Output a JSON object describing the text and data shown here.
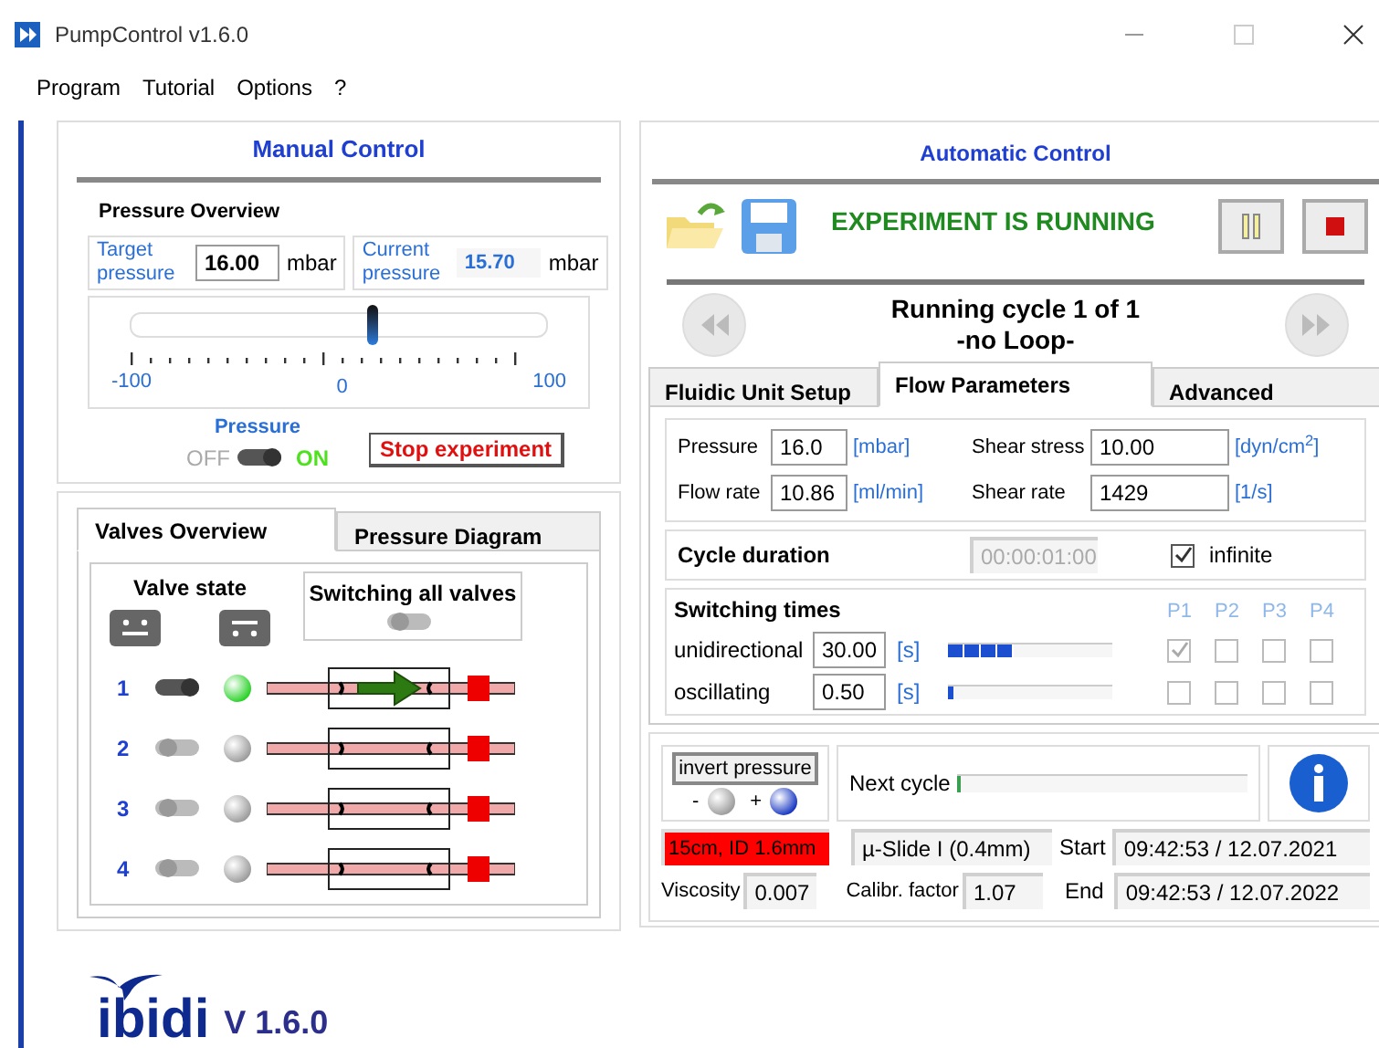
{
  "window": {
    "title": "PumpControl v1.6.0"
  },
  "menu": [
    "Program",
    "Tutorial",
    "Options",
    "?"
  ],
  "manual_control": {
    "title": "Manual Control",
    "section": "Pressure Overview",
    "target": {
      "label": "Target pressure",
      "value": "16.00",
      "unit": "mbar"
    },
    "current": {
      "label": "Current pressure",
      "value": "15.70",
      "unit": "mbar"
    },
    "slider": {
      "level": 0.58,
      "labels": [
        "-100",
        "0",
        "100"
      ]
    },
    "pressure_label": "Pressure",
    "toggle": {
      "off_label": "OFF",
      "on_label": "ON",
      "on": true
    },
    "stop_button": "Stop experiment"
  },
  "left_tabs": [
    {
      "label": "Valves Overview",
      "selected": true
    },
    {
      "label": "Pressure Diagram",
      "selected": false
    }
  ],
  "valves": {
    "state_label": "Valve state",
    "switch_all_label": "Switching all valves",
    "rows": [
      {
        "number": "1",
        "on": true
      },
      {
        "number": "2",
        "on": false
      },
      {
        "number": "3",
        "on": false
      },
      {
        "number": "4",
        "on": false
      }
    ]
  },
  "logo": {
    "brand": "ibidi",
    "version": "V 1.6.0"
  },
  "automatic_control": {
    "title": "Automatic Control",
    "status": "EXPERIMENT IS RUNNING",
    "cycle_lines": [
      "Running cycle 1 of 1",
      "-no Loop-"
    ],
    "tabs": [
      {
        "label": "Fluidic Unit Setup",
        "selected": false
      },
      {
        "label": "Flow Parameters",
        "selected": true
      },
      {
        "label": "Advanced",
        "selected": false
      }
    ],
    "params": [
      {
        "label": "Pressure",
        "value": "16.0",
        "unit": "[mbar]"
      },
      {
        "label": "Shear stress",
        "value": "10.00",
        "unit": "[dyn/cm$^{2}$]"
      },
      {
        "label": "Flow rate",
        "value": "10.86",
        "unit": "[ml/min]"
      },
      {
        "label": "Shear rate",
        "value": "1429",
        "unit": "[1/s]"
      }
    ],
    "cycle_duration": {
      "label": "Cycle duration",
      "value": "00:00:01:00",
      "infinite_label": "infinite",
      "infinite": true
    },
    "switching": {
      "title": "Switching times",
      "columns": [
        "P1",
        "P2",
        "P3",
        "P4"
      ],
      "rows": [
        {
          "label": "unidirectional",
          "value": "30.00",
          "unit": "[s]",
          "level": 0.4,
          "checks": [
            true,
            false,
            false,
            false
          ]
        },
        {
          "label": "oscillating",
          "value": "0.50",
          "unit": "[s]",
          "level": 0.03,
          "checks": [
            false,
            false,
            false,
            false
          ]
        }
      ]
    },
    "invert_button": "invert pressure",
    "minus": "-",
    "plus": "+",
    "polarity_positive": true,
    "next_cycle": {
      "label": "Next cycle",
      "level": 0.01
    },
    "tubing": "15cm, ID 1.6mm",
    "slide": "µ-Slide I (0.4mm)",
    "start": {
      "label": "Start",
      "value": "09:42:53 / 12.07.2021"
    },
    "viscosity": {
      "label": "Viscosity",
      "value": "0.007"
    },
    "calibration": {
      "label": "Calibr. factor",
      "value": "1.07"
    },
    "end": {
      "label": "End",
      "value": "09:42:53 / 12.07.2022"
    }
  }
}
